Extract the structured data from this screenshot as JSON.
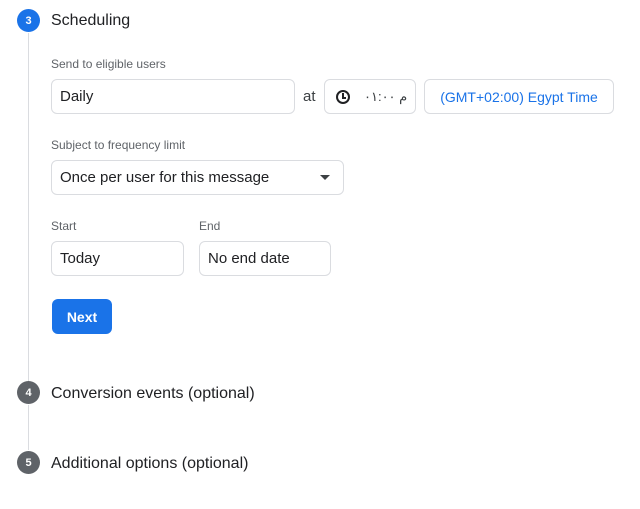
{
  "steps": [
    {
      "number": "3",
      "title": "Scheduling",
      "state": "active"
    },
    {
      "number": "4",
      "title": "Conversion events (optional)",
      "state": "inactive"
    },
    {
      "number": "5",
      "title": "Additional options (optional)",
      "state": "inactive"
    }
  ],
  "scheduling": {
    "send_label": "Send to eligible users",
    "frequency_value": "Daily",
    "at_label": "at",
    "time_value": "م ۰۱:۰۰",
    "timezone": "(GMT+02:00) Egypt Time",
    "limit_label": "Subject to frequency limit",
    "limit_value": "Once per user for this message",
    "start_label": "Start",
    "start_value": "Today",
    "end_label": "End",
    "end_value": "No end date",
    "next_label": "Next"
  },
  "colors": {
    "accent": "#1a73e8",
    "inactive_step": "#5f6368",
    "border": "#dadce0"
  },
  "icons": {
    "time": "clock-icon",
    "dropdown": "dropdown-arrow-icon"
  }
}
